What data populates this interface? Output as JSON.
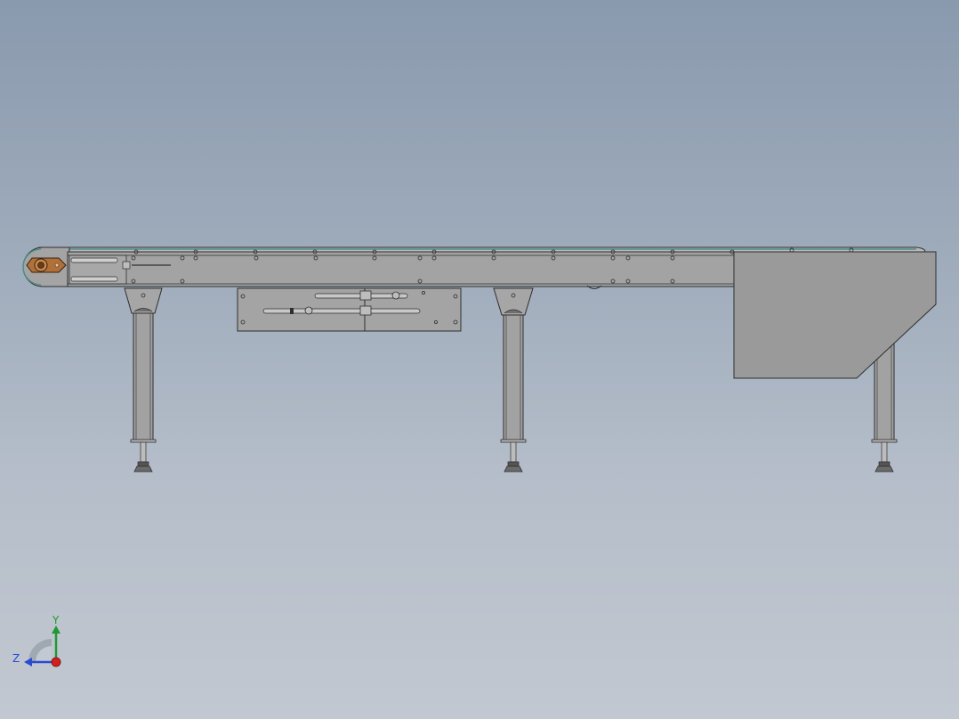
{
  "viewport": {
    "background_top": "#8a9aae",
    "background_bottom": "#c2c8d1"
  },
  "model": {
    "frame_color": "#a0a0a0",
    "frame_stroke": "#2e2e2e",
    "belt_accent": "#4f8f8a",
    "drive_color": "#b0703a",
    "hopper_color": "#9a9a9a"
  },
  "triad": {
    "y_label": "Y",
    "z_label": "Z",
    "y_color": "#1f9a32",
    "z_color": "#2a4ad0",
    "x_color": "#d21e1e"
  }
}
